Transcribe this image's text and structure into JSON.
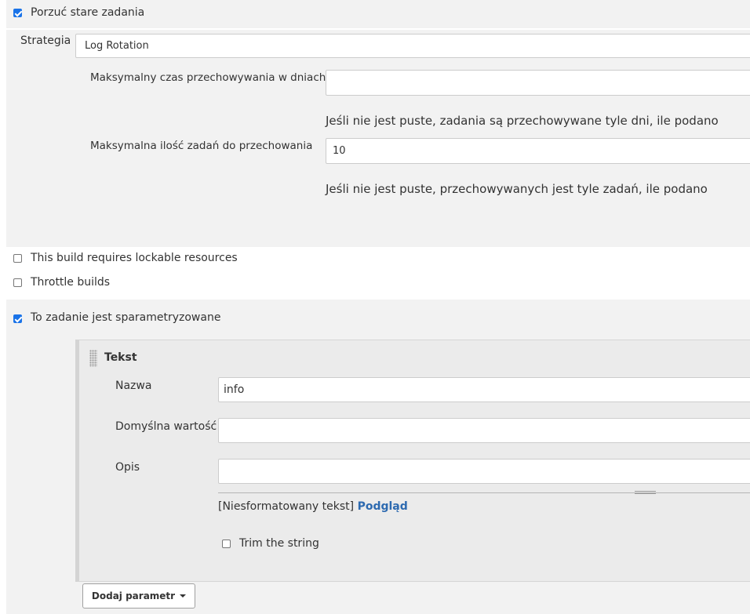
{
  "discard_old": {
    "label": "Porzuć stare zadania",
    "checked": true,
    "strategy_label": "Strategia",
    "strategy_value": "Log Rotation",
    "days_label": "Maksymalny czas przechowywania w dniach",
    "days_value": "",
    "days_help": "Jeśli nie jest puste, zadania są przechowywane tyle dni, ile podano",
    "count_label": "Maksymalna ilość zadań do przechowania",
    "count_value": "10",
    "count_help": "Jeśli nie jest puste, przechowywanych jest tyle zadań, ile podano"
  },
  "lockable": {
    "label": "This build requires lockable resources",
    "checked": false
  },
  "throttle": {
    "label": "Throttle builds",
    "checked": false
  },
  "parameterized": {
    "label": "To zadanie jest sparametryzowane",
    "checked": true
  },
  "parameter": {
    "title": "Tekst",
    "name_label": "Nazwa",
    "name_value": "info",
    "default_label": "Domyślna wartość",
    "default_value": "",
    "desc_label": "Opis",
    "desc_value": "",
    "format_text": "[Niesformatowany tekst]",
    "preview_link": "Podgląd",
    "trim_label": "Trim the string",
    "trim_checked": false
  },
  "add_param_button": "Dodaj parametr",
  "colors": {
    "link": "#2d6ab0",
    "checkbox_checked": "#1a73e8",
    "section_bg": "#f2f2f2",
    "panel_bg": "#ebebeb"
  }
}
